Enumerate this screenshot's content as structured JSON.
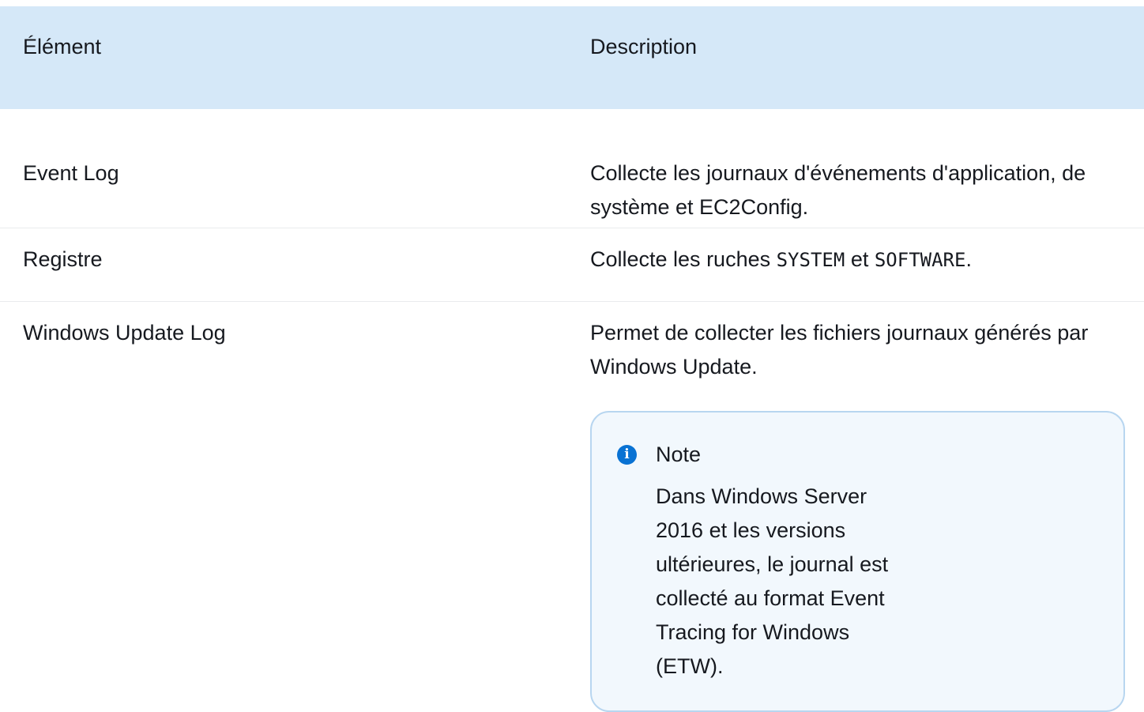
{
  "table": {
    "headers": [
      "Élément",
      "Description"
    ],
    "rows": [
      {
        "element": "Event Log",
        "description": "Collecte les journaux d'événements d'application, de système et EC2Config."
      },
      {
        "element": "Registre",
        "description_prefix": "Collecte les ruches ",
        "code1": "SYSTEM",
        "description_mid": " et ",
        "code2": "SOFTWARE",
        "description_suffix": "."
      },
      {
        "element": "Windows Update Log",
        "description": "Permet de collecter les fichiers journaux générés par Windows Update.",
        "note": {
          "title": "Note",
          "icon": "info-icon",
          "body": "Dans Windows Server 2016 et les versions ultérieures, le journal est collecté au format Event Tracing for Windows (ETW)."
        }
      }
    ]
  },
  "colors": {
    "header_bg": "#d5e8f8",
    "note_bg": "#f2f8fd",
    "note_border": "#b8d6f0",
    "info_icon": "#0972d3"
  }
}
